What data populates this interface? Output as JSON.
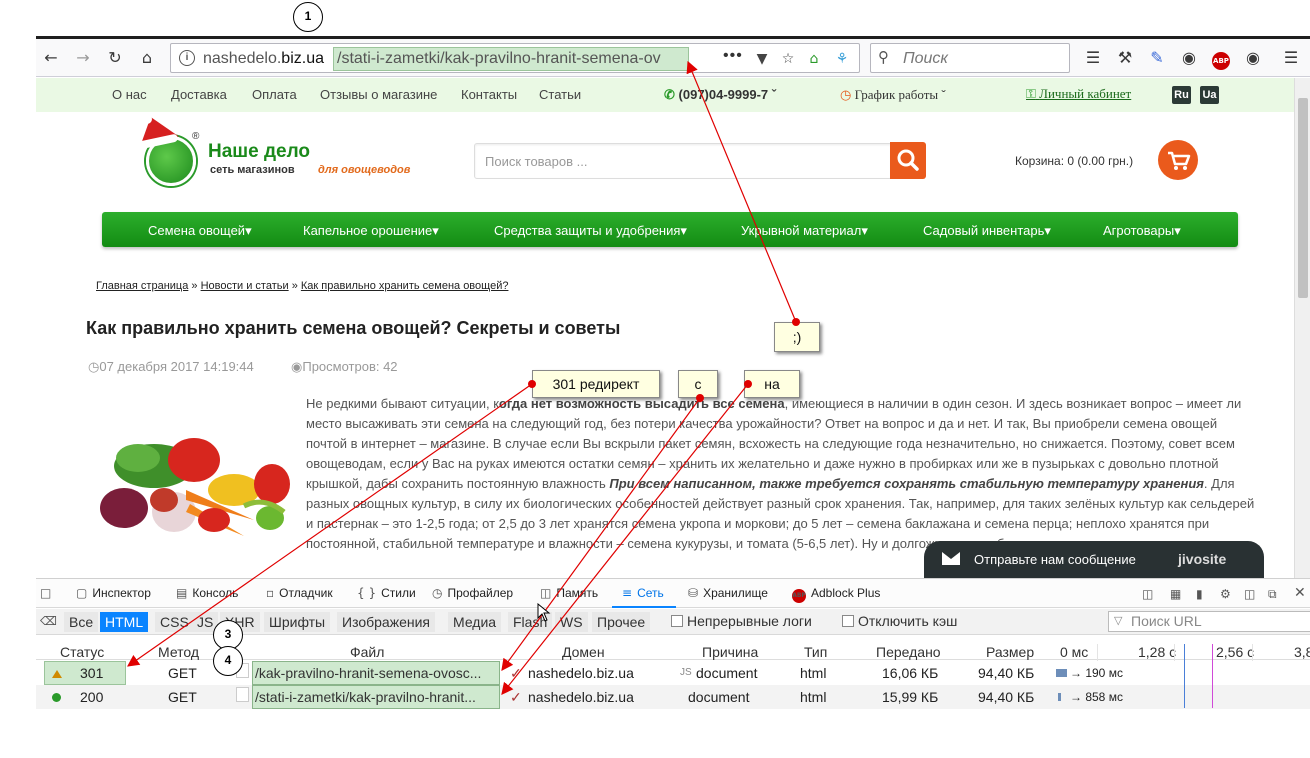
{
  "browser": {
    "url_host_prefix": "nashedelo.",
    "url_host_domain": "biz.ua",
    "url_path": "/stati-i-zametki/kak-pravilno-hranit-semena-ov",
    "url_more": "•••",
    "search_placeholder": "Поиск"
  },
  "site": {
    "top_links": [
      "О нас",
      "Доставка",
      "Оплата",
      "Отзывы о магазине",
      "Контакты",
      "Статьи"
    ],
    "phone": "(097)04-9999-7",
    "schedule": "График работы",
    "account": "Личный кабинет",
    "lang_ru": "Ru",
    "lang_ua": "Ua",
    "logo_title": "Наше дело",
    "logo_sub": "сеть магазинов",
    "logo_tagline": "для овощеводов",
    "logo_reg": "®",
    "search_placeholder": "Поиск товаров ...",
    "cart": "Корзина: 0 (0.00 грн.)",
    "menu": [
      "Семена овощей",
      "Капельное орошение",
      "Средства защиты и удобрения",
      "Укрывной материал",
      "Садовый инвентарь",
      "Агротовары"
    ]
  },
  "article": {
    "crumb_home": "Главная страница",
    "crumb_news": "Новости и статьи",
    "crumb_current": "Как правильно хранить семена овощей?",
    "crumb_sep": "»",
    "title": "Как правильно хранить семена овощей? Секреты и советы",
    "date": "07 декабря 2017 14:19:44",
    "views": "Просмотров: 42",
    "p_start": "Не редкими бывают ситуации, к",
    "p_bold": "огда нет возможность высадить все семена",
    "p_mid": ", имеющиеся в наличии в один сезон. И здесь возникает вопрос – имеет ли место высаживать эти семена на следующий год, без потери качества урожайности? Ответ на вопрос и да и нет. И так, Вы приобрели семена овощей почтой в интернет – магазине. В случае если Вы вскрыли пакет семян, всхожесть на следующие года незначительно, но снижается. Поэтому, совет всем овощеводам, если у Вас на руках имеются остатки семян – хранить их желательно и даже нужно в пробирках или же в пузырьках с довольно плотной крышкой, дабы сохранить постоянную влажность ",
    "p_italic": "При всем написанном, также требуется сохранять стабильную температуру хранения",
    "p_end": ". Для разных овощных культур, в силу их биологических особенностей действует разный срок хранения. Так, например, для таких зелёных культур как сельдерей и пастернак – это 1-2,5 года; от 2,5 до 3 лет хранятся семена укропа и моркови; до 5 лет – семена баклажана и семена перца; неплохо хранятся при постоянной, стабильной температуре и влажности – семена кукурузы, и томата (5-6,5 лет). Ну и долгожители – кабачки"
  },
  "jivo": {
    "message": "Отправьте нам сообщение",
    "brand": "jivosite"
  },
  "devtools": {
    "tabs": [
      "Инспектор",
      "Консоль",
      "Отладчик",
      "Стили",
      "Профайлер",
      "Память",
      "Сеть",
      "Хранилище",
      "Adblock Plus"
    ],
    "filters": [
      "Все",
      "HTML",
      "CSS",
      "JS",
      "XHR",
      "Шрифты",
      "Изображения",
      "Медиа",
      "Flash",
      "WS",
      "Прочее"
    ],
    "persist_logs": "Непрерывные логи",
    "disable_cache": "Отключить кэш",
    "filter_url_placeholder": "Поиск URL",
    "columns": [
      "Статус",
      "Метод",
      "Файл",
      "Домен",
      "Причина",
      "Тип",
      "Передано",
      "Размер",
      "0 мс",
      "1,28 с",
      "2,56 с",
      "3,8"
    ],
    "requests": [
      {
        "status": "301",
        "method": "GET",
        "file": "/kak-pravilno-hranit-semena-ovosc...",
        "domain": "nashedelo.biz.ua",
        "cause": "document",
        "type": "html",
        "transferred": "16,06 КБ",
        "size": "94,40 КБ",
        "timing": "→ 190 мс"
      },
      {
        "status": "200",
        "method": "GET",
        "file": "/stati-i-zametki/kak-pravilno-hranit...",
        "domain": "nashedelo.biz.ua",
        "cause": "document",
        "type": "html",
        "transferred": "15,99 КБ",
        "size": "94,40 КБ",
        "timing": "→ 858 мс"
      }
    ]
  },
  "annotations": {
    "n1": "1",
    "n3": "3",
    "n4": "4",
    "smiley": ";)",
    "redirect": "301 редирект",
    "from": "с",
    "to": "на"
  },
  "colors": {
    "accent_green": "#1a8a1a",
    "accent_orange": "#ea5a1c",
    "highlight": "#cfe9cf",
    "devtools_blue": "#0a84ff",
    "arrow_red": "#e00000"
  }
}
